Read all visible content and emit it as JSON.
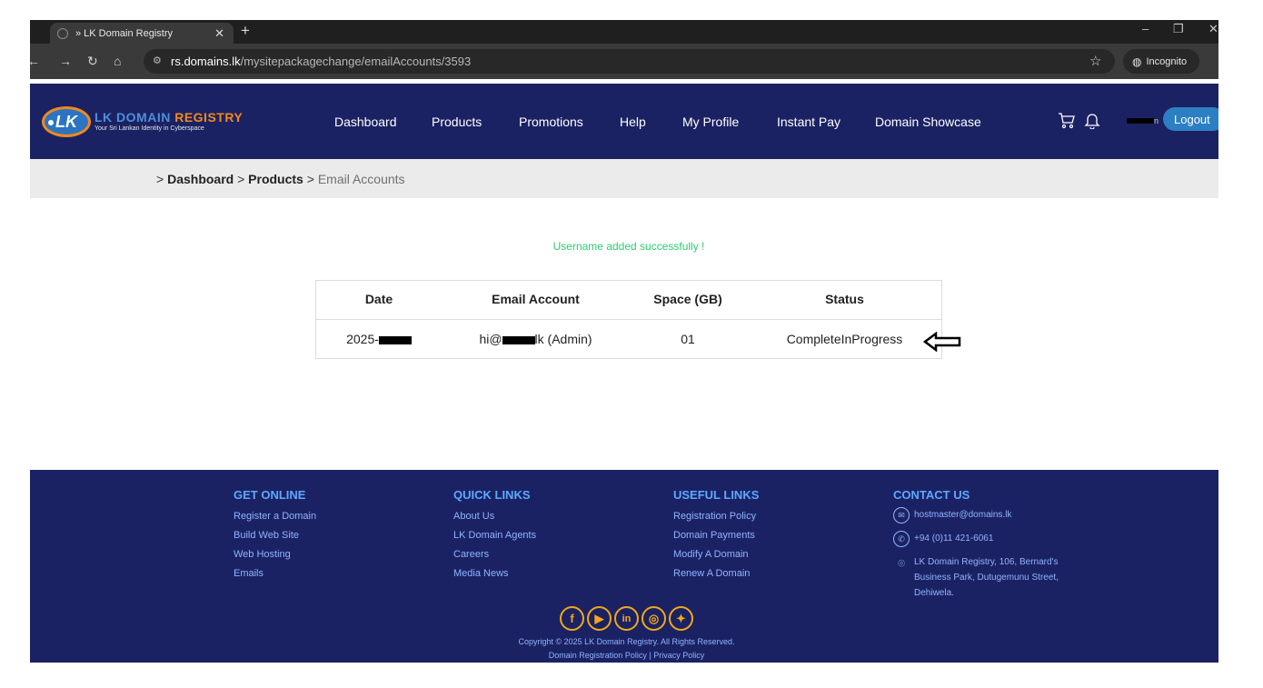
{
  "browser": {
    "tab_title": "» LK Domain Registry",
    "url_domain": "rs.domains.lk",
    "url_path": "/mysitepackagechange/emailAccounts/3593",
    "incognito_label": "Incognito"
  },
  "header": {
    "logo_badge": "LK",
    "logo_word1": "LK DOMAIN",
    "logo_word2": "REGISTRY",
    "logo_tagline": "Your Sri Lankan Identity in Cyberspace",
    "nav": [
      "Dashboard",
      "Products",
      "Promotions",
      "Help",
      "My Profile",
      "Instant Pay",
      "Domain Showcase"
    ],
    "logout_label": "Logout",
    "user_name_tail": "n"
  },
  "breadcrumb": {
    "prefix": ">",
    "item1": "Dashboard",
    "sep": ">",
    "item2": "Products",
    "current": "Email Accounts"
  },
  "message": "Username added successfully !",
  "table": {
    "columns": [
      "Date",
      "Email Account",
      "Space (GB)",
      "Status"
    ],
    "row": {
      "date_prefix": "2025-",
      "email_prefix": "hi@",
      "email_suffix": "lk (Admin)",
      "space": "01",
      "status": "CompleteInProgress"
    }
  },
  "footer": {
    "get_online": {
      "title": "GET ONLINE",
      "links": [
        "Register a Domain",
        "Build Web Site",
        "Web Hosting",
        "Emails"
      ]
    },
    "quick_links": {
      "title": "QUICK LINKS",
      "links": [
        "About Us",
        "LK Domain Agents",
        "Careers",
        "Media News"
      ]
    },
    "useful_links": {
      "title": "USEFUL LINKS",
      "links": [
        "Registration Policy",
        "Domain Payments",
        "Modify A Domain",
        "Renew A Domain"
      ]
    },
    "contact": {
      "title": "CONTACT US",
      "email": "hostmaster@domains.lk",
      "phone": "+94 (0)11 421-6061",
      "address": "LK Domain Registry, 106, Bernard's Business Park, Dutugemunu Street, Dehiwela."
    },
    "social_icons": [
      "facebook-icon",
      "youtube-icon",
      "linkedin-icon",
      "instagram-icon",
      "twitter-icon"
    ],
    "copyright": "Copyright © 2025 LK Domain Registry. All Rights Reserved.",
    "policy_link1": "Domain Registration Policy",
    "policy_sep": "|",
    "policy_link2": "Privacy Policy"
  },
  "colors": {
    "header_bg": "#1b2263",
    "accent_orange": "#f08a1c",
    "success_green": "#2ecc71",
    "logout_blue": "#2c7fc2",
    "footer_link": "#8fb4ff"
  }
}
